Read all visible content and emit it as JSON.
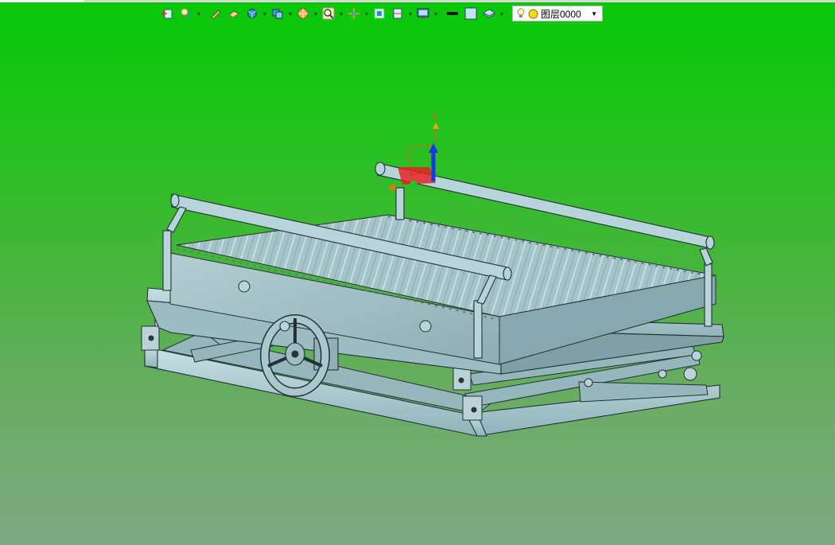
{
  "toolbar": {
    "buttons": [
      {
        "name": "exit-sketch-icon",
        "has_menu": false
      },
      {
        "name": "light-bulb-icon",
        "has_menu": true
      },
      {
        "name": "pen-icon",
        "has_menu": false
      },
      {
        "name": "eraser-icon",
        "has_menu": false
      },
      {
        "name": "cube-icon",
        "has_menu": true
      },
      {
        "name": "view-orient-icon",
        "has_menu": true
      },
      {
        "name": "render-style-icon",
        "has_menu": true
      },
      {
        "name": "zoom-icon",
        "has_menu": true
      },
      {
        "name": "pan-icon",
        "has_menu": true
      },
      {
        "name": "fit-view-icon",
        "has_menu": false
      },
      {
        "name": "section-icon",
        "has_menu": true
      },
      {
        "name": "display-icon",
        "has_menu": true
      },
      {
        "name": "line-color-icon",
        "has_menu": false
      },
      {
        "name": "fill-color-icon",
        "has_menu": false
      },
      {
        "name": "layer-manager-icon",
        "has_menu": true
      }
    ],
    "layer": {
      "label": "图层0000"
    }
  },
  "colors": {
    "accent": "#00c800",
    "model": "#9fc3c9",
    "outline": "#243034"
  },
  "triad": {
    "label": "Z"
  }
}
